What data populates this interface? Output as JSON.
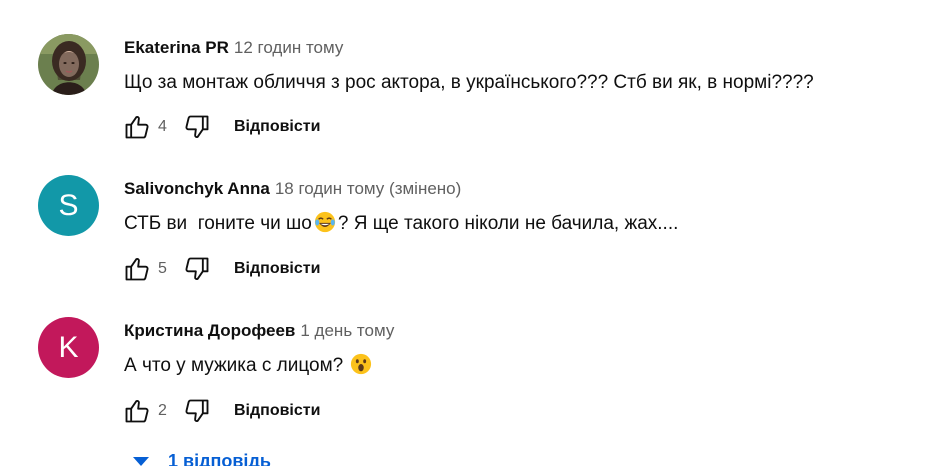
{
  "comments": [
    {
      "author": "Ekaterina PR",
      "time": "12 годин тому",
      "text": "Що за монтаж обличчя з рос актора, в українського??? Стб ви як, в нормі????",
      "likes": "4",
      "reply_label": "Відповісти",
      "avatar": {
        "type": "photo"
      }
    },
    {
      "author": "Salivonchyk Anna",
      "time": "18 годин тому (змінено)",
      "text_before": "СТБ ви  гоните чи шо",
      "text_after": "? Я ще такого ніколи не бачила, жах....",
      "emoji": "tears-of-joy-emoji",
      "likes": "5",
      "reply_label": "Відповісти",
      "avatar": {
        "type": "letter",
        "letter": "S",
        "color": "#1298a8"
      }
    },
    {
      "author": "Кристина Дорофеев",
      "time": "1 день тому",
      "text_before": "А что у мужика с лицом? ",
      "emoji": "astonished-emoji",
      "likes": "2",
      "reply_label": "Відповісти",
      "avatar": {
        "type": "letter",
        "letter": "K",
        "color": "#c2185b"
      }
    }
  ],
  "replies_toggle": {
    "label": "1 відповідь",
    "color": "#065fd4"
  }
}
